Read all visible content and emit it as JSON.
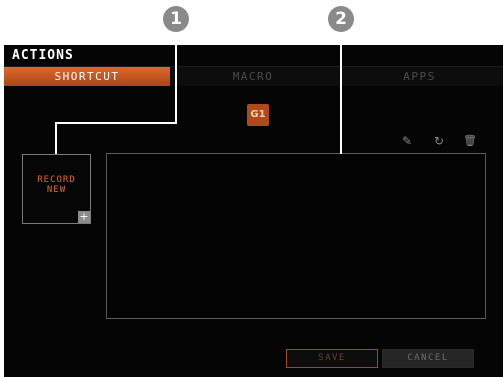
{
  "callouts": [
    "1",
    "2"
  ],
  "panel": {
    "title": "ACTIONS",
    "tabs": [
      {
        "label": "SHORTCUT",
        "active": true
      },
      {
        "label": "MACRO",
        "active": false
      },
      {
        "label": "APPS",
        "active": false
      }
    ],
    "g_key_badge": "G1",
    "record": {
      "line1": "RECORD",
      "line2": "NEW",
      "plus": "+"
    },
    "tools": [
      {
        "name": "pencil-icon",
        "glyph": "✎"
      },
      {
        "name": "redo-icon",
        "glyph": "↻"
      },
      {
        "name": "trash-icon",
        "glyph": "🗑"
      }
    ],
    "buttons": {
      "save": "SAVE",
      "cancel": "CANCEL"
    }
  },
  "colors": {
    "accent": "#e0692a",
    "background": "#050505",
    "border": "#5a5a5a"
  }
}
